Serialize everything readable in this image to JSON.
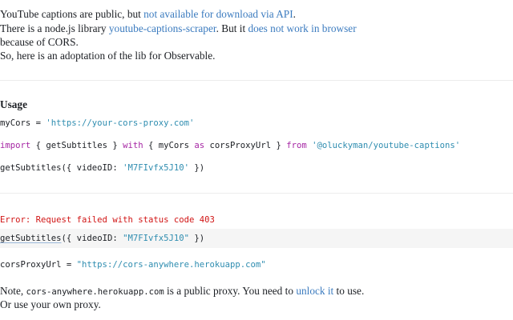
{
  "intro": {
    "line1_text": "YouTube captions are public, but ",
    "line1_link": "not available for download via API",
    "line1_end": ".",
    "line2_text": "There is a node.js library ",
    "line2_link1": "youtube-captions-scraper",
    "line2_mid": ". But it ",
    "line2_link2": "does not work in browser",
    "line3_text": "because of CORS.",
    "line4_text": "So, here is an adoptation of the lib for Observable."
  },
  "usage": {
    "heading": "Usage",
    "code1": {
      "lhs": "myCors = ",
      "str": "'https://your-cors-proxy.com'"
    },
    "code2": {
      "kw_import": "import",
      "p1": " { getSubtitles } ",
      "kw_with": "with",
      "p2": " { myCors ",
      "kw_as": "as",
      "p3": " corsProxyUrl } ",
      "kw_from": "from",
      "p4": " ",
      "str": "'@oluckyman/youtube-captions'"
    },
    "code3": {
      "pre": "getSubtitles({ videoID: ",
      "str": "'M7FIvfx5J10'",
      "post": " })"
    }
  },
  "output": {
    "error": "Error: Request failed with status code 403",
    "cell_fn": "getSubtitles",
    "cell_pre": "({ videoID: ",
    "cell_str": "\"M7FIvfx5J10\"",
    "cell_post": " })",
    "proxy_lhs": "corsProxyUrl = ",
    "proxy_str": "\"https://cors-anywhere.herokuapp.com\""
  },
  "note": {
    "pre": "Note, ",
    "code": "cors-anywhere.herokuapp.com",
    "mid": " is a public proxy. You need to ",
    "link": "unlock it",
    "post": " to use.",
    "line2": "Or use your own proxy."
  },
  "colors": {
    "link": "#3b7bbf",
    "keyword": "#a626a4",
    "string": "#2f8db0",
    "error": "#d11515"
  }
}
